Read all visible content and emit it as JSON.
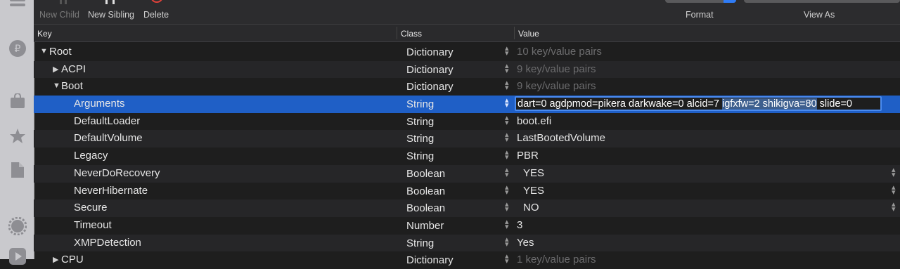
{
  "toolbar": {
    "new_child": "New Child",
    "new_sibling": "New Sibling",
    "delete": "Delete",
    "format": "Format",
    "view_as": "View As"
  },
  "columns": {
    "key": "Key",
    "class": "Class",
    "value": "Value"
  },
  "rows": [
    {
      "key": "Root",
      "class": "Dictionary",
      "value": "10 key/value pairs",
      "indent": 0,
      "disclosure": "expanded",
      "muted": true
    },
    {
      "key": "ACPI",
      "class": "Dictionary",
      "value": "9 key/value pairs",
      "indent": 1,
      "disclosure": "collapsed",
      "muted": true
    },
    {
      "key": "Boot",
      "class": "Dictionary",
      "value": "9 key/value pairs",
      "indent": 1,
      "disclosure": "expanded",
      "muted": true
    },
    {
      "key": "Arguments",
      "class": "String",
      "value": "dart=0 agdpmod=pikera darkwake=0 alcid=7 igfxfw=2 shikigva=80 slide=0",
      "indent": 2,
      "selected": true,
      "editing": true
    },
    {
      "key": "DefaultLoader",
      "class": "String",
      "value": "boot.efi",
      "indent": 2
    },
    {
      "key": "DefaultVolume",
      "class": "String",
      "value": "LastBootedVolume",
      "indent": 2
    },
    {
      "key": "Legacy",
      "class": "String",
      "value": "PBR",
      "indent": 2
    },
    {
      "key": "NeverDoRecovery",
      "class": "Boolean",
      "value": "YES",
      "indent": 2,
      "popup": true
    },
    {
      "key": "NeverHibernate",
      "class": "Boolean",
      "value": "YES",
      "indent": 2,
      "popup": true
    },
    {
      "key": "Secure",
      "class": "Boolean",
      "value": "NO",
      "indent": 2,
      "popup": true
    },
    {
      "key": "Timeout",
      "class": "Number",
      "value": "3",
      "indent": 2
    },
    {
      "key": "XMPDetection",
      "class": "String",
      "value": "Yes",
      "indent": 2
    },
    {
      "key": "CPU",
      "class": "Dictionary",
      "value": "1 key/value pairs",
      "indent": 1,
      "disclosure": "collapsed",
      "muted": true
    }
  ],
  "editing": {
    "before": "dart=0 agdpmod=pikera darkwake=0 alcid=7 ",
    "highlight": "igfxfw=2 shikigva=80",
    "after": " slide=0"
  },
  "colors": {
    "selection": "#1f5fc6",
    "focus_ring": "#4a8bf0",
    "delete_red": "#e0413a",
    "accent": "#2f7cf6"
  },
  "dock_icons": [
    "list-icon",
    "ruble-icon",
    "bag-icon",
    "star-icon",
    "document-icon",
    "gear-icon",
    "play-icon"
  ]
}
